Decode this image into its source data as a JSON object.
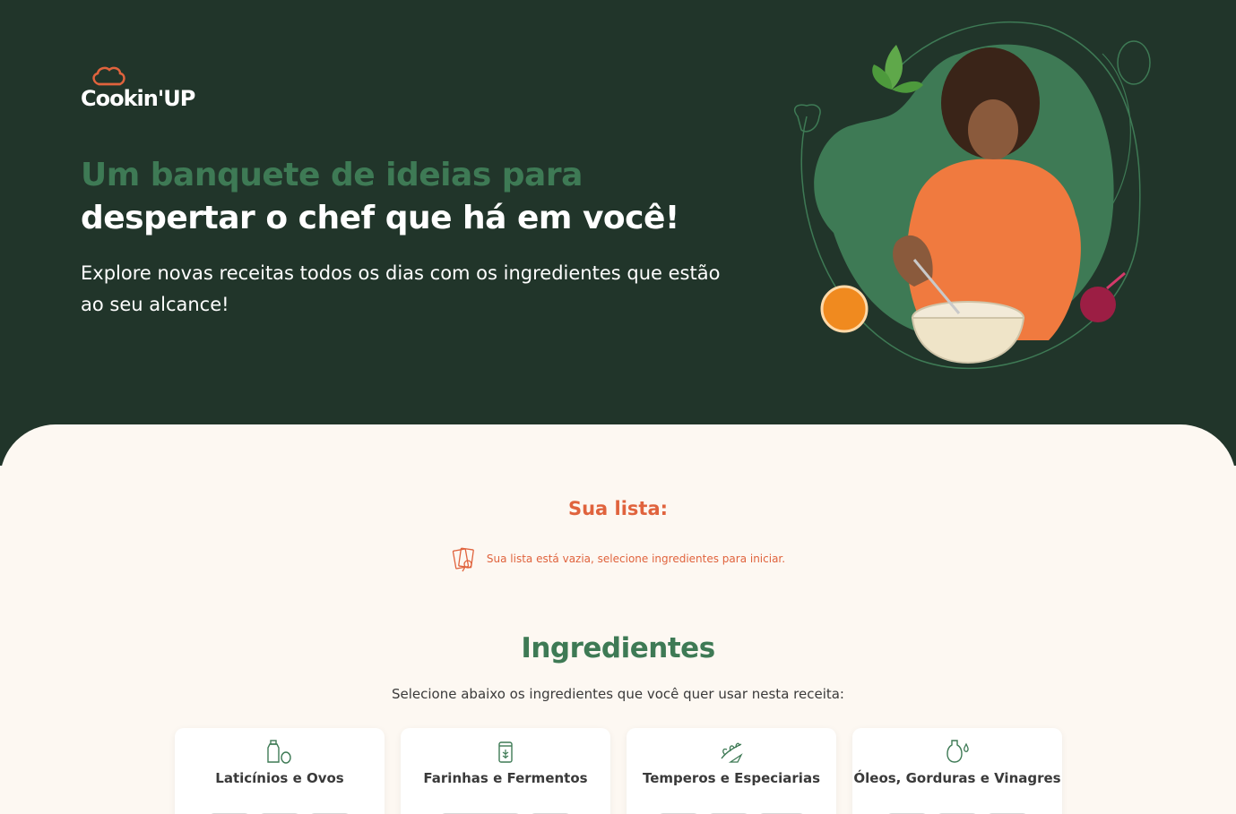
{
  "brand": {
    "name": "Cookin'UP"
  },
  "hero": {
    "headline_line1": "Um banquete de ideias para",
    "headline_line2": "despertar o chef que há em você!",
    "subtitle": "Explore novas receitas todos os dias com os ingredientes que estão ao seu alcance!"
  },
  "list": {
    "title": "Sua lista:",
    "empty_message": "Sua lista está vazia, selecione ingredientes para iniciar."
  },
  "ingredients": {
    "title": "Ingredientes",
    "subtitle": "Selecione abaixo os ingredientes que você quer usar nesta receita:",
    "categories": [
      {
        "label": "Laticínios e Ovos",
        "icon": "dairy-eggs-icon"
      },
      {
        "label": "Farinhas e Fermentos",
        "icon": "flour-jar-icon"
      },
      {
        "label": "Temperos e Especiarias",
        "icon": "spices-icon"
      },
      {
        "label": "Óleos, Gorduras e Vinagres",
        "icon": "oil-bottle-icon"
      }
    ]
  },
  "colors": {
    "hero_bg": "#21352a",
    "accent_green": "#3e7a55",
    "accent_orange": "#e0633d",
    "content_bg": "#fdf8f2"
  }
}
